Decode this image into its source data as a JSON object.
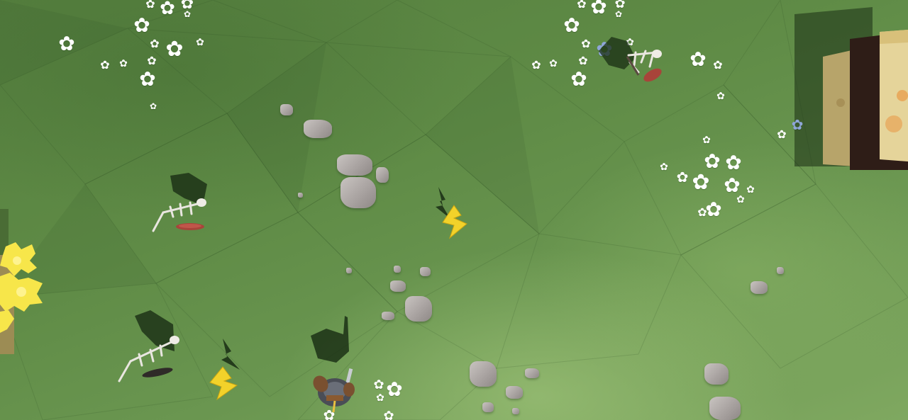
{
  "scene": {
    "view": "top-down",
    "terrain": "low-poly grass field",
    "colors": {
      "grass": "#5f8b46",
      "grass_light": "#a9c985",
      "flower": "#ffffff",
      "flower_blue": "#8fa6d8",
      "rock": "#b0aaa8",
      "lightning": "#f2d22a",
      "fire": "#f7e64a",
      "building_wall": "#e8d79a",
      "building_roof": "#3a2620",
      "shield_red": "#a8443a"
    }
  },
  "entities": [
    {
      "type": "skeleton-enemy",
      "icon": "skeleton-icon"
    },
    {
      "type": "skeleton-enemy",
      "icon": "skeleton-icon"
    },
    {
      "type": "skeleton-enemy",
      "icon": "skeleton-icon"
    },
    {
      "type": "player-knight",
      "icon": "knight-icon"
    }
  ],
  "pickups": [
    {
      "type": "lightning-powerup",
      "icon": "lightning-bolt-icon"
    },
    {
      "type": "lightning-powerup",
      "icon": "lightning-bolt-icon"
    }
  ],
  "props": [
    {
      "type": "building",
      "icon": "house-icon"
    },
    {
      "type": "bonfire",
      "icon": "fire-icon"
    }
  ]
}
